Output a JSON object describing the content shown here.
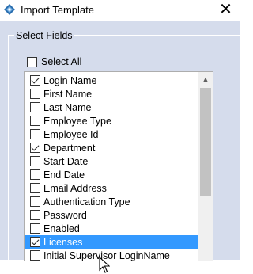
{
  "window": {
    "title": "Import Template",
    "close_glyph": "✕",
    "app_icon": "import-template-app-icon"
  },
  "group": {
    "title": "Select Fields"
  },
  "select_all": {
    "label": "Select All",
    "checked": false
  },
  "fields": [
    {
      "label": "Login Name",
      "checked": true
    },
    {
      "label": "First Name",
      "checked": false
    },
    {
      "label": "Last Name",
      "checked": false
    },
    {
      "label": "Employee Type",
      "checked": false
    },
    {
      "label": "Employee Id",
      "checked": false
    },
    {
      "label": "Department",
      "checked": true
    },
    {
      "label": "Start Date",
      "checked": false
    },
    {
      "label": "End Date",
      "checked": false
    },
    {
      "label": "Email Address",
      "checked": false
    },
    {
      "label": "Authentication Type",
      "checked": false
    },
    {
      "label": "Password",
      "checked": false
    },
    {
      "label": "Enabled",
      "checked": false
    },
    {
      "label": "Licenses",
      "checked": true,
      "selected": true
    },
    {
      "label": "Initial Supervisor LoginName",
      "checked": false
    }
  ],
  "scrollbar": {
    "up_glyph": "▲"
  },
  "colors": {
    "client_bg": "#d5dcec",
    "selection": "#3399ff"
  }
}
